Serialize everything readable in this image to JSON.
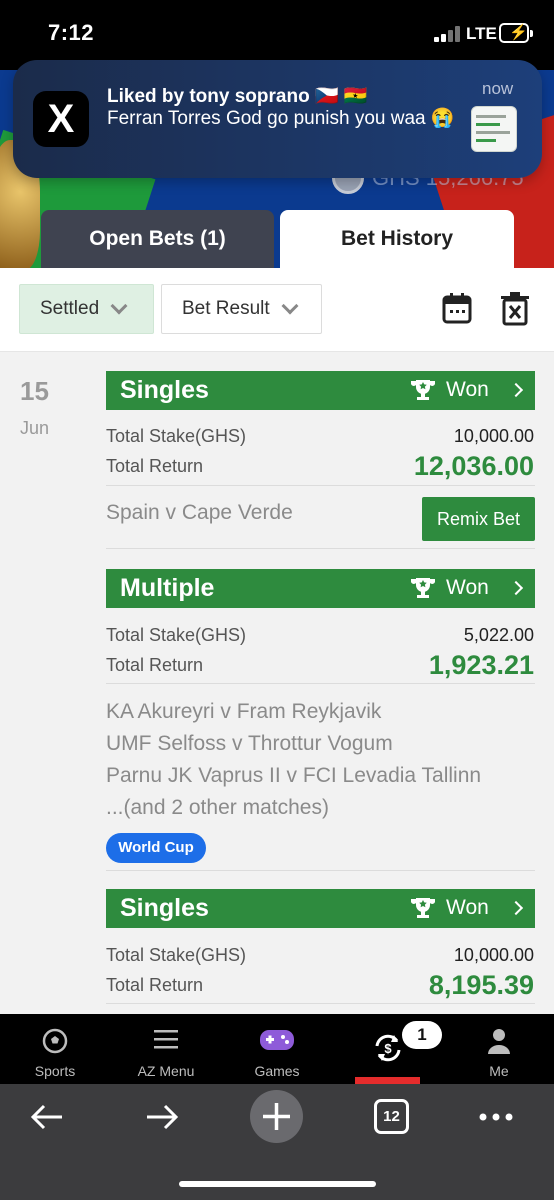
{
  "status_bar": {
    "time": "7:12",
    "network": "LTE"
  },
  "notification": {
    "app_icon": "X",
    "title": "Liked by tony soprano 🇨🇿 🇬🇭",
    "body": "Ferran Torres God go punish you waa 😭",
    "time": "now"
  },
  "header": {
    "balance": "GHS 15,266.75"
  },
  "tabs": [
    {
      "label": "Open Bets (1)",
      "active": false
    },
    {
      "label": "Bet History",
      "active": true
    }
  ],
  "filters": {
    "settled": "Settled",
    "bet_result": "Bet Result"
  },
  "date": {
    "day": "15",
    "month": "Jun"
  },
  "labels": {
    "stake": "Total Stake(GHS)",
    "return": "Total Return"
  },
  "bets": [
    {
      "type": "Singles",
      "status": "Won",
      "stake": "10,000.00",
      "return": "12,036.00",
      "matches": [
        "Spain v Cape Verde"
      ],
      "action": "Remix Bet"
    },
    {
      "type": "Multiple",
      "status": "Won",
      "stake": "5,022.00",
      "return": "1,923.21",
      "matches": [
        "KA Akureyri v Fram Reykjavik",
        "UMF Selfoss v Throttur Vogum",
        "Parnu JK Vaprus II v FCI Levadia Tallinn",
        "...(and 2 other matches)"
      ],
      "badge": "World Cup"
    },
    {
      "type": "Singles",
      "status": "Won",
      "stake": "10,000.00",
      "return": "8,195.39"
    }
  ],
  "bottom_nav": [
    {
      "label": "Sports",
      "icon": "soccer-ball-icon"
    },
    {
      "label": "AZ Menu",
      "icon": "hamburger-menu-icon"
    },
    {
      "label": "Games",
      "icon": "gamepad-icon"
    },
    {
      "label": "",
      "icon": "cashout-icon",
      "badge": "1",
      "active": true
    },
    {
      "label": "Me",
      "icon": "user-icon"
    }
  ],
  "browser": {
    "tab_count": "12"
  },
  "colors": {
    "brand_green": "#2e8b3e",
    "active_red": "#e52c2c",
    "badge_blue": "#1d6ee8"
  }
}
